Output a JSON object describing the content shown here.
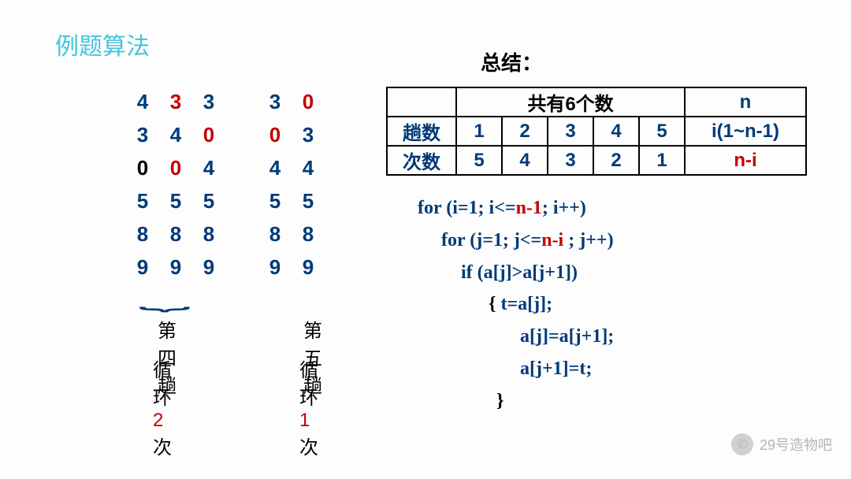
{
  "title": "例题算法",
  "numbers": {
    "rows": [
      [
        "4",
        "3",
        "3",
        "",
        "3",
        "0"
      ],
      [
        "3",
        "4",
        "0",
        "",
        "0",
        "3"
      ],
      [
        "0",
        "0",
        "4",
        "",
        "4",
        "4"
      ],
      [
        "5",
        "5",
        "5",
        "",
        "5",
        "5"
      ],
      [
        "8",
        "8",
        "8",
        "",
        "8",
        "8"
      ],
      [
        "9",
        "9",
        "9",
        "",
        "9",
        "9"
      ]
    ],
    "colors": [
      [
        "navy",
        "red",
        "navy",
        "",
        "navy",
        "red"
      ],
      [
        "navy",
        "navy",
        "red",
        "",
        "red",
        "navy"
      ],
      [
        "black",
        "red",
        "navy",
        "",
        "navy",
        "navy"
      ],
      [
        "navy",
        "navy",
        "navy",
        "",
        "navy",
        "navy"
      ],
      [
        "navy",
        "navy",
        "navy",
        "",
        "navy",
        "navy"
      ],
      [
        "navy",
        "navy",
        "navy",
        "",
        "navy",
        "navy"
      ]
    ]
  },
  "passes": {
    "label4": "第四趟",
    "label5": "第五趟",
    "loop4_prefix": "循环",
    "loop4_count": "2",
    "loop4_suffix": "次",
    "loop5_prefix": "循环",
    "loop5_count": "1",
    "loop5_suffix": "次"
  },
  "summary": {
    "title": "总结：",
    "top_text": "共有",
    "top_bold": "6",
    "top_suffix": "个数",
    "n": "n",
    "row2_label": "趟数",
    "row2_vals": [
      "1",
      "2",
      "3",
      "4",
      "5"
    ],
    "row2_right": "i(1~n-1)",
    "row3_label": "次数",
    "row3_vals": [
      "5",
      "4",
      "3",
      "2",
      "1"
    ],
    "row3_right": "n-i"
  },
  "code": {
    "l1a": "for (i=1; i<=",
    "l1b": "n-1",
    "l1c": "; i++)",
    "l2a": "for (j=1; j<=",
    "l2b": "n-i",
    "l2c": " ; j++)",
    "l3": "if (a[j]>a[j+1])",
    "l4a": "{  ",
    "l4b": "t=a[j];",
    "l5": "a[j]=a[j+1];",
    "l6": "a[j+1]=t;",
    "l7": "}"
  },
  "watermark": "29号造物吧"
}
